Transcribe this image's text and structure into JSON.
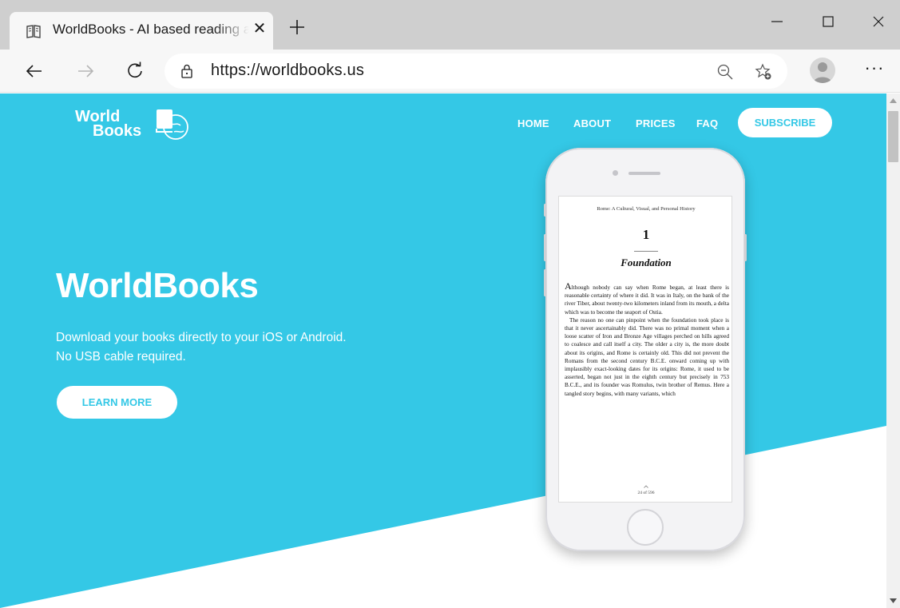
{
  "browser": {
    "tab_title": "WorldBooks - AI based reading app",
    "url": "https://worldbooks.us"
  },
  "site": {
    "logo_line1": "World",
    "logo_line2": "Books",
    "nav": [
      "HOME",
      "ABOUT",
      "PRICES",
      "FAQ"
    ],
    "subscribe_label": "SUBSCRIBE",
    "hero_title": "WorldBooks",
    "hero_sub_line1": "Download your books directly to your iOS or Android.",
    "hero_sub_line2": "No USB cable required.",
    "learn_more_label": "LEARN MORE"
  },
  "book": {
    "header": "Rome: A Cultural, Visual, and Personal History",
    "chapter_number": "1",
    "chapter_title": "Foundation",
    "drop_cap": "A",
    "paragraph1": "lthough nobody can say when Rome began, at least there is reasonable certainty of where it did. It was in Italy, on the bank of the river Tiber, about twenty-two kilometers inland from its mouth, a delta which was to become the seaport of Ostia.",
    "paragraph2": "The reason no one can pinpoint when the foundation took place is that it never ascertainably did. There was no primal moment when a loose scatter of Iron and Bronze Age villages perched on hills agreed to coalesce and call itself a city. The older a city is, the more doubt about its origins, and Rome is certainly old. This did not prevent the Romans from the second century B.C.E. onward coming up with implausibly exact-looking dates for its origins: Rome, it used to be asserted, began not just in the eighth century but precisely in 753 B.C.E., and its founder was Romulus, twin brother of Remus. Here a tangled story begins, with many variants, which",
    "page_count": "24 of 596"
  },
  "colors": {
    "hero": "#34c8e6",
    "white": "#ffffff"
  }
}
